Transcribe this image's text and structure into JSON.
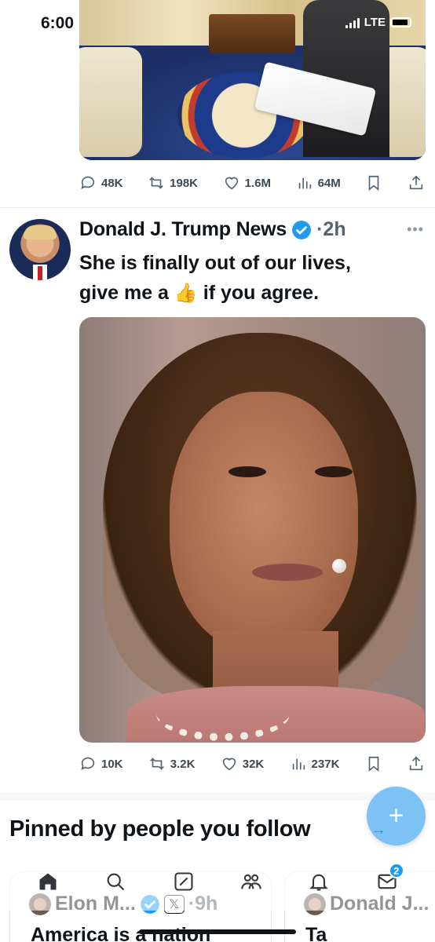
{
  "status_bar": {
    "time": "6:00",
    "network": "LTE"
  },
  "top_post": {
    "stats": {
      "replies": "48K",
      "reposts": "198K",
      "likes": "1.6M",
      "views": "64M"
    }
  },
  "tweet": {
    "display_name": "Donald J. Trump News",
    "time": "·2h",
    "text_line1": "She is finally out of our lives,",
    "text_pre_emoji": "give me a ",
    "emoji": "👍",
    "text_post_emoji": " if you agree.",
    "stats": {
      "replies": "10K",
      "reposts": "3.2K",
      "likes": "32K",
      "views": "237K"
    }
  },
  "pinned": {
    "title": "Pinned by people you follow",
    "cards": [
      {
        "name": "Elon M...",
        "x_badge": "𝕏",
        "time": "·9h",
        "text": "America is a nation"
      },
      {
        "name": "Donald J...",
        "text": "Ta"
      }
    ]
  },
  "tabbar": {
    "messages_badge": "2"
  },
  "colors": {
    "accent": "#1d9bf0",
    "text": "#0f1419",
    "muted": "#536471",
    "fab": "#7ec1f4"
  }
}
